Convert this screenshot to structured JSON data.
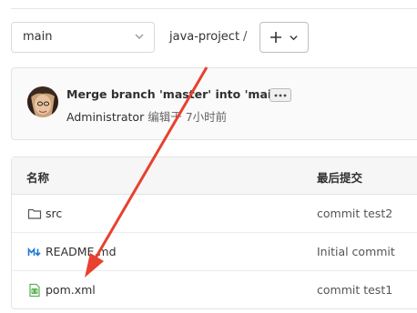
{
  "branch": {
    "selected": "main"
  },
  "breadcrumb": {
    "project": "java-project",
    "separator": "/"
  },
  "commit": {
    "title": "Merge branch 'master' into 'main'",
    "author": "Administrator",
    "time": "编辑于 7小时前"
  },
  "table": {
    "headers": {
      "name": "名称",
      "last_commit": "最后提交"
    },
    "rows": [
      {
        "name": "src",
        "commit": "commit test2",
        "icon": "folder-icon"
      },
      {
        "name": "README.md",
        "commit": "Initial commit",
        "icon": "markdown-icon"
      },
      {
        "name": "pom.xml",
        "commit": "commit test1",
        "icon": "xml-file-icon"
      }
    ]
  },
  "annotation": {
    "color": "#e8412f",
    "points_to": "pom.xml"
  },
  "colors": {
    "markdown": "#1f78d1",
    "xml": "#5bb053"
  }
}
